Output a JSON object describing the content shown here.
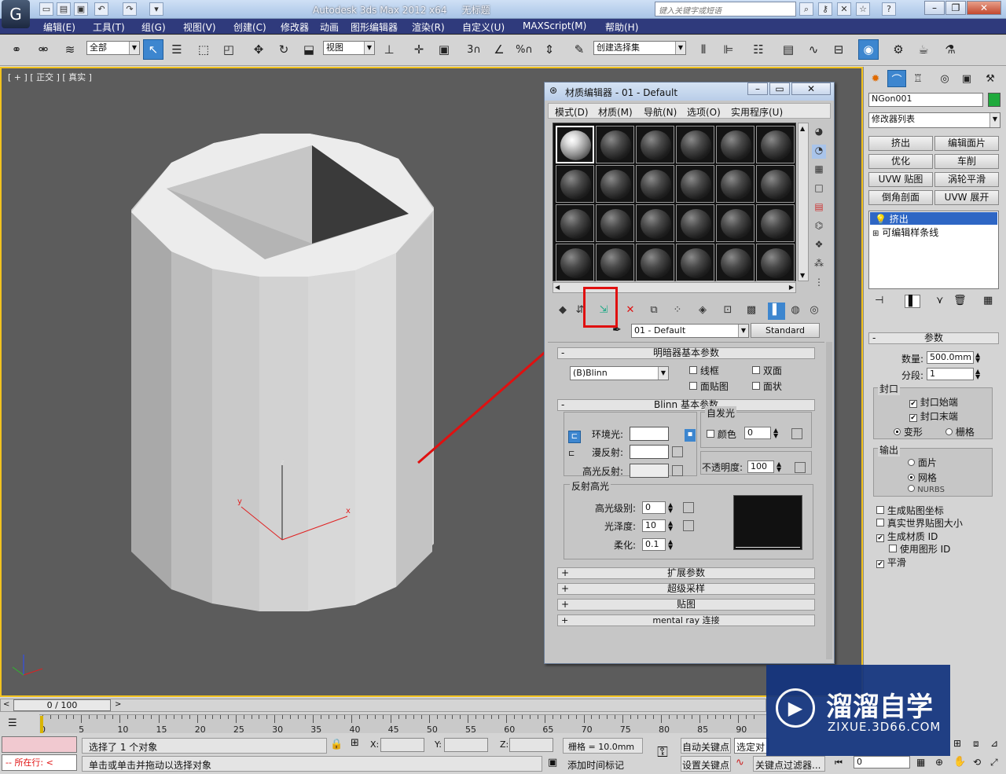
{
  "app": {
    "title": "Autodesk 3ds Max  2012 x64",
    "doc": "无标题",
    "search_placeholder": "键入关键字或短语"
  },
  "menu": [
    "编辑(E)",
    "工具(T)",
    "组(G)",
    "视图(V)",
    "创建(C)",
    "修改器",
    "动画",
    "图形编辑器",
    "渲染(R)",
    "自定义(U)",
    "MAXScript(M)",
    "帮助(H)"
  ],
  "toolbar": {
    "filter": "全部",
    "refcoord": "视图",
    "selset": "创建选择集",
    "snaps": [
      "3",
      "%"
    ]
  },
  "viewport": {
    "label": "[ + ] [ 正交 ] [ 真实 ]",
    "axes": {
      "x": "x",
      "y": "y",
      "z": "z"
    }
  },
  "cmdpanel": {
    "object_name": "NGon001",
    "object_color": "#1faa3c",
    "modifier_list": "修改器列表",
    "mod_buttons": [
      "挤出",
      "编辑面片",
      "优化",
      "车削",
      "UVW 贴图",
      "涡轮平滑",
      "倒角剖面",
      "UVW 展开"
    ],
    "stack": [
      "挤出",
      "可编辑样条线"
    ],
    "rollout": {
      "title": "参数",
      "amount_label": "数量:",
      "amount": "500.0mm",
      "segments_label": "分段:",
      "segments": "1",
      "cap_group": "封口",
      "cap_start": "封口始端",
      "cap_end": "封口末端",
      "morph": "变形",
      "grid": "栅格",
      "output_group": "输出",
      "patch": "面片",
      "mesh": "网格",
      "nurbs": "NURBS",
      "gen_map": "生成贴图坐标",
      "real_world": "真实世界贴图大小",
      "gen_matid": "生成材质 ID",
      "use_shape_id": "使用图形 ID",
      "smooth": "平滑"
    }
  },
  "material_editor": {
    "title": "材质编辑器 - 01 - Default",
    "menu": [
      "模式(D)",
      "材质(M)",
      "导航(N)",
      "选项(O)",
      "实用程序(U)"
    ],
    "material_name": "01 - Default",
    "material_type": "Standard",
    "shader_rollout": "明暗器基本参数",
    "shader": "(B)Blinn",
    "wire": "线框",
    "two_sided": "双面",
    "face_map": "面贴图",
    "faceted": "面状",
    "blinn_rollout": "Blinn 基本参数",
    "self_illum": "自发光",
    "color": "颜色",
    "self_illum_val": "0",
    "ambient": "环境光:",
    "diffuse": "漫反射:",
    "specular": "高光反射:",
    "opacity": "不透明度:",
    "opacity_val": "100",
    "spec_group": "反射高光",
    "spec_level": "高光级别:",
    "spec_level_val": "0",
    "glossiness": "光泽度:",
    "glossiness_val": "10",
    "soften": "柔化:",
    "soften_val": "0.1",
    "closed_rollouts": [
      "扩展参数",
      "超级采样",
      "贴图",
      "mental ray 连接"
    ],
    "plus": "+",
    "minus": "-"
  },
  "timeline": {
    "frame": "0 / 100",
    "ticks": [
      "0",
      "5",
      "10",
      "15",
      "20",
      "25",
      "30",
      "35",
      "40",
      "45",
      "50",
      "55",
      "60",
      "65",
      "70",
      "75",
      "80",
      "85",
      "90"
    ]
  },
  "status": {
    "selected": "选择了 1 个对象",
    "hint": "单击或单击并拖动以选择对象",
    "running": "所在行:",
    "x": "X:",
    "y": "Y:",
    "z": "Z:",
    "grid": "栅格 = 10.0mm",
    "autokey": "自动关键点",
    "setkey": "设置关键点",
    "selmode": "选定对",
    "add_tag": "添加时间标记",
    "key_filter": "关键点过滤器...",
    "frame_val": "0"
  },
  "watermark": {
    "brand": "溜溜自学",
    "url": "ZIXUE.3D66.COM"
  }
}
